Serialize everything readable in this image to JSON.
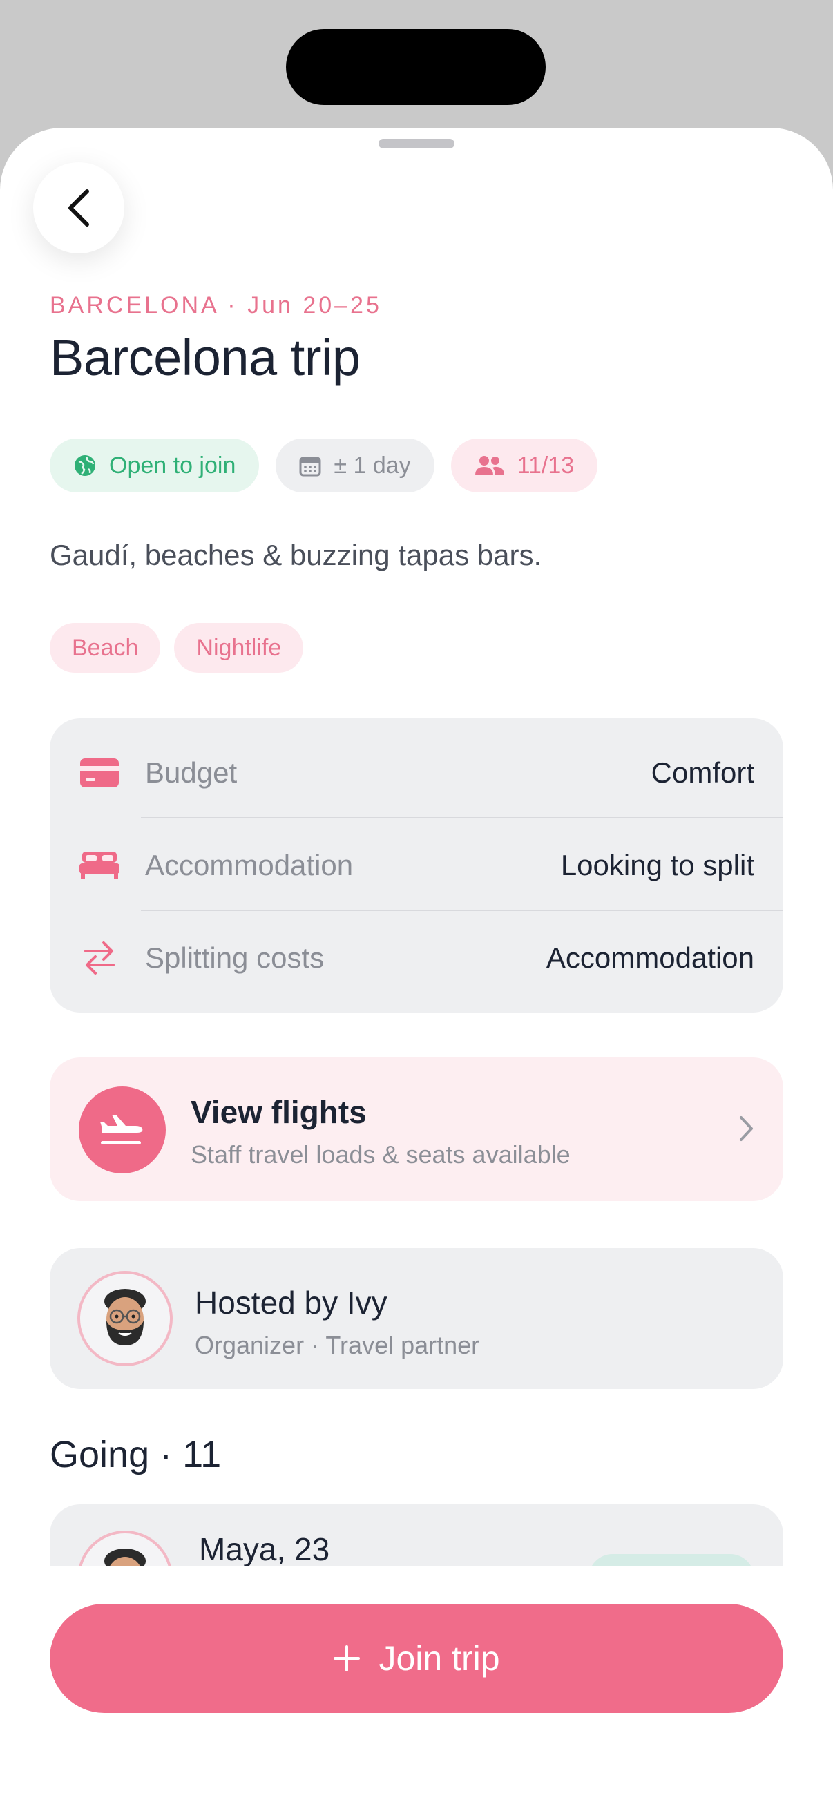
{
  "header": {
    "kicker": "BARCELONA · Jun 20–25",
    "title": "Barcelona trip"
  },
  "chips": {
    "open": "Open to join",
    "flex": "± 1 day",
    "count": "11/13"
  },
  "description": "Gaudí, beaches & buzzing tapas bars.",
  "tags": [
    "Beach",
    "Nightlife"
  ],
  "info": [
    {
      "icon": "credit-card-icon",
      "label": "Budget",
      "value": "Comfort"
    },
    {
      "icon": "bed-icon",
      "label": "Accommodation",
      "value": "Looking to split"
    },
    {
      "icon": "swap-arrows-icon",
      "label": "Splitting costs",
      "value": "Accommodation"
    }
  ],
  "flights": {
    "title": "View flights",
    "subtitle": "Staff travel loads & seats available"
  },
  "host": {
    "name": "Hosted by Ivy",
    "subtitle": "Organizer · Travel partner"
  },
  "going": {
    "heading": "Going · 11",
    "first_member": "Maya, 23"
  },
  "join_button": "Join trip",
  "colors": {
    "accent": "#f06c8a",
    "green": "#2fb076",
    "card": "#eeeff1"
  }
}
